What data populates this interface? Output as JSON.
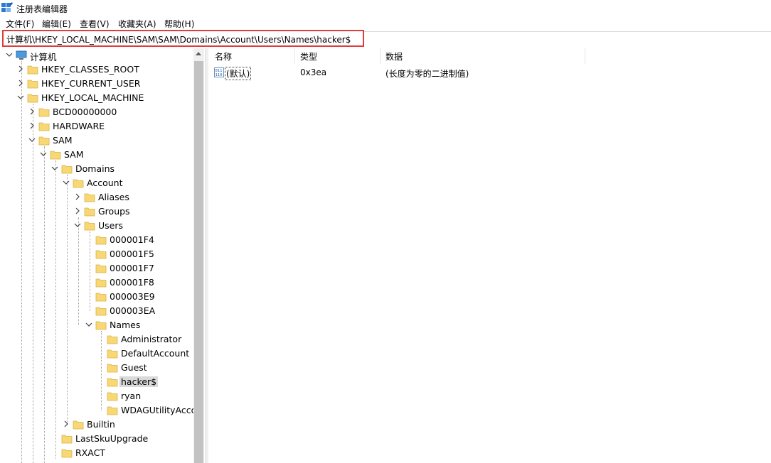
{
  "window": {
    "title": "注册表编辑器"
  },
  "menu": [
    "文件(F)",
    "编辑(E)",
    "查看(V)",
    "收藏夹(A)",
    "帮助(H)"
  ],
  "address": {
    "path": "计算机\\HKEY_LOCAL_MACHINE\\SAM\\SAM\\Domains\\Account\\Users\\Names\\hacker$"
  },
  "tree": {
    "root": "计算机",
    "nodes": [
      "HKEY_CLASSES_ROOT",
      "HKEY_CURRENT_USER",
      "HKEY_LOCAL_MACHINE",
      "BCD00000000",
      "HARDWARE",
      "SAM",
      "SAM",
      "Domains",
      "Account",
      "Aliases",
      "Groups",
      "Users",
      "000001F4",
      "000001F5",
      "000001F7",
      "000001F8",
      "000003E9",
      "000003EA",
      "Names",
      "Administrator",
      "DefaultAccount",
      "Guest",
      "hacker$",
      "ryan",
      "WDAGUtilityAccount",
      "Builtin",
      "LastSkuUpgrade",
      "RXACT"
    ],
    "selected": "hacker$"
  },
  "columns": {
    "name": "名称",
    "type": "类型",
    "data": "数据"
  },
  "values": [
    {
      "name": "(默认)",
      "type": "0x3ea",
      "data": "(长度为零的二进制值)"
    }
  ],
  "colors": {
    "highlight_border": "#e03c3c",
    "folder": "#f8d775",
    "selection": "#d9d9d9"
  }
}
